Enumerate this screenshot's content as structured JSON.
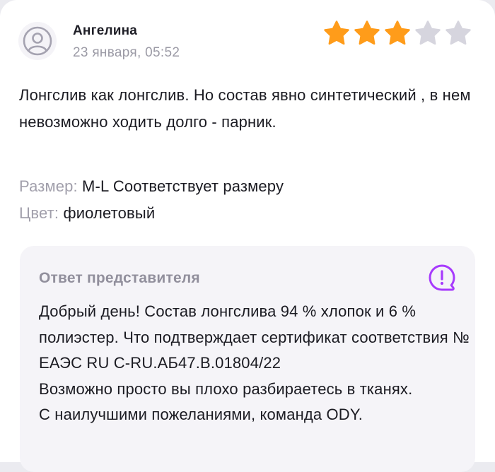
{
  "review": {
    "author": "Ангелина",
    "date": "23 января, 05:52",
    "rating": 3,
    "max_rating": 5,
    "text": "Лонгслив как лонгслив. Но состав явно синтетический , в нем невозможно ходить долго - парник.",
    "size_label": "Размер:",
    "size_value": "M-L Соответствует размеру",
    "color_label": "Цвет:",
    "color_value": "фиолетовый"
  },
  "answer": {
    "title": "Ответ представителя",
    "text": "Добрый день! Состав лонгслива 94 % хлопок и 6 % полиэстер. Что подтверждает сертификат соответствия № ЕАЭС RU С-RU.АБ47.В.01804/22\nВозможно просто вы плохо разбираетесь в тканях.\nС наилучшими пожеланиями, команда ODY."
  },
  "icons": {
    "avatar": "user-avatar-icon",
    "star": "star-icon",
    "answer": "warning-chat-icon"
  },
  "colors": {
    "star_filled": "#ff9c1a",
    "star_empty": "#d6d5de",
    "accent": "#a73afd"
  }
}
